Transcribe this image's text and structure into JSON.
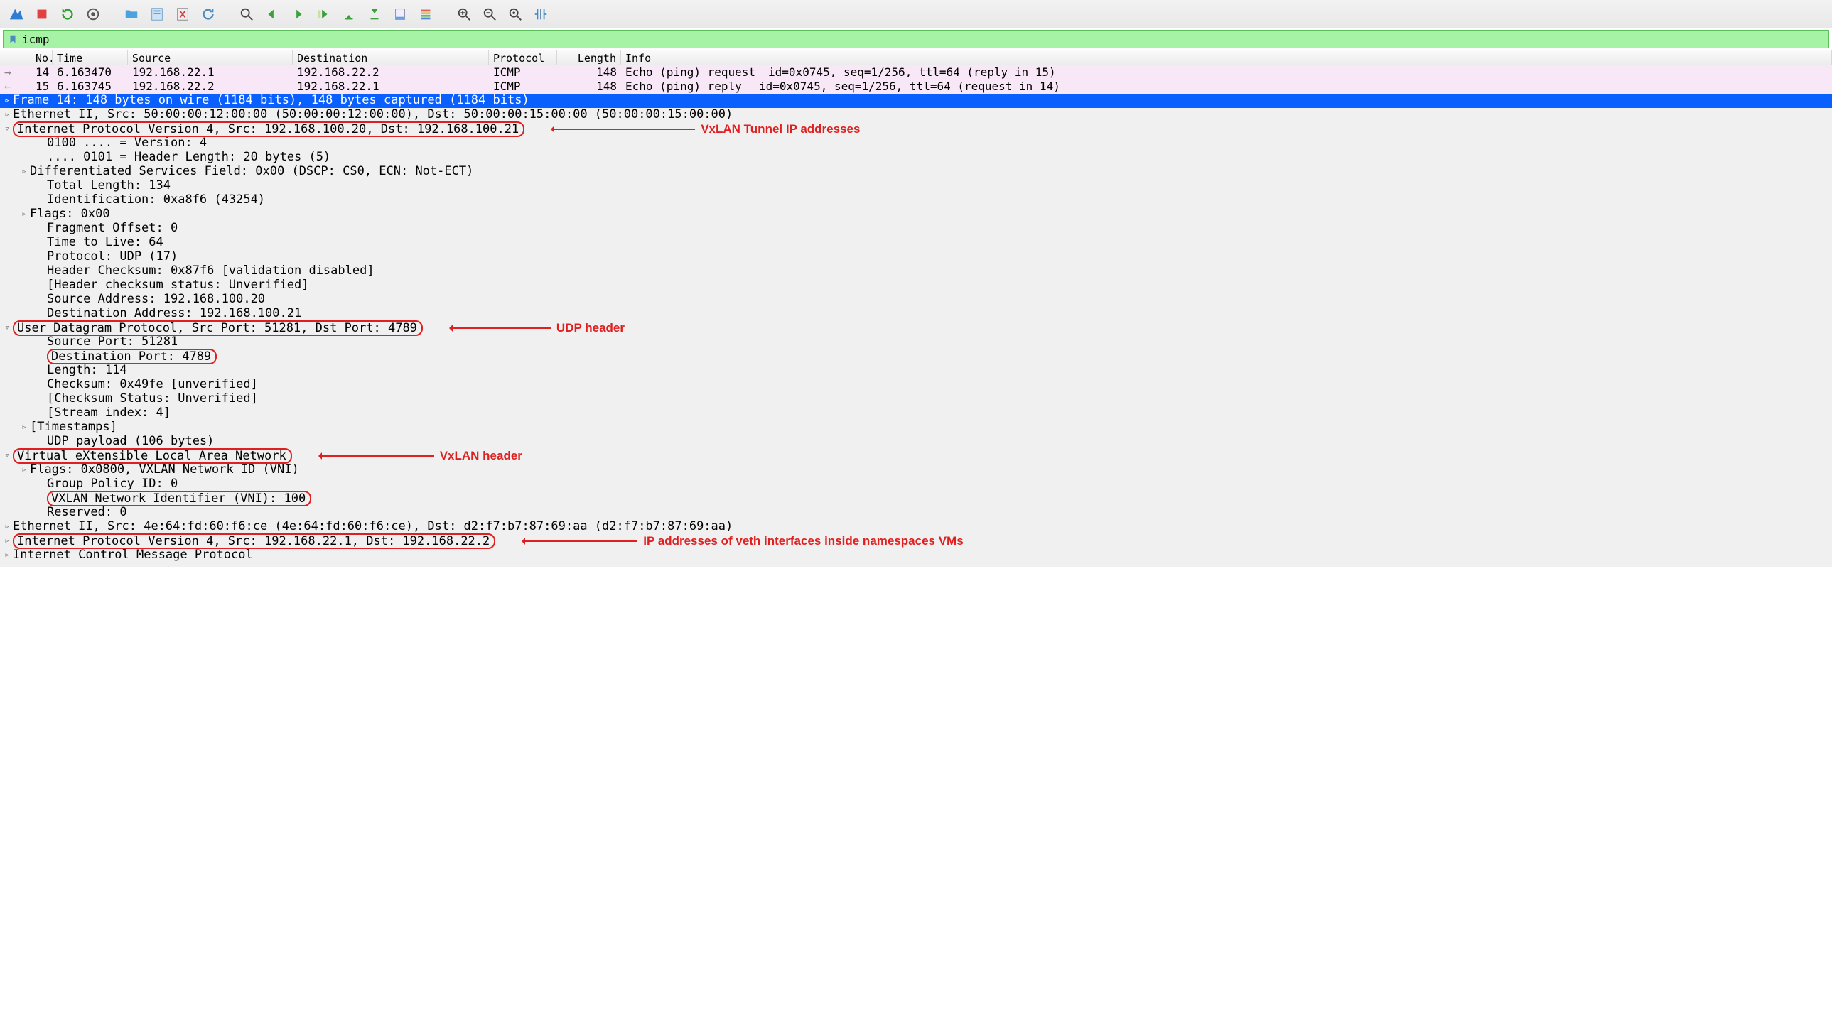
{
  "filter": {
    "value": "icmp"
  },
  "columns": {
    "no": "No.",
    "time": "Time",
    "src": "Source",
    "dst": "Destination",
    "proto": "Protocol",
    "len": "Length",
    "info": "Info"
  },
  "packets": [
    {
      "dir": "right",
      "no": "14",
      "time": "6.163470",
      "src": "192.168.22.1",
      "dst": "192.168.22.2",
      "proto": "ICMP",
      "len": "148",
      "infoDesc": "Echo (ping) request",
      "infoTail": "id=0x0745, seq=1/256, ttl=64 (reply in 15)"
    },
    {
      "dir": "left",
      "no": "15",
      "time": "6.163745",
      "src": "192.168.22.2",
      "dst": "192.168.22.1",
      "proto": "ICMP",
      "len": "148",
      "infoDesc": "Echo (ping) reply",
      "infoTail": "id=0x0745, seq=1/256, ttl=64 (request in 14)"
    }
  ],
  "tree": {
    "frame": "Frame 14: 148 bytes on wire (1184 bits), 148 bytes captured (1184 bits)",
    "eth1": "Ethernet II, Src: 50:00:00:12:00:00 (50:00:00:12:00:00), Dst: 50:00:00:15:00:00 (50:00:00:15:00:00)",
    "ip_outer": "Internet Protocol Version 4, Src: 192.168.100.20, Dst: 192.168.100.21",
    "ip_outer_fields": {
      "version": "0100 .... = Version: 4",
      "hlen": ".... 0101 = Header Length: 20 bytes (5)",
      "dsf": "Differentiated Services Field: 0x00 (DSCP: CS0, ECN: Not-ECT)",
      "tlen": "Total Length: 134",
      "ident": "Identification: 0xa8f6 (43254)",
      "flags": "Flags: 0x00",
      "foff": "Fragment Offset: 0",
      "ttl": "Time to Live: 64",
      "proto": "Protocol: UDP (17)",
      "hcksum": "Header Checksum: 0x87f6 [validation disabled]",
      "hckstat": "[Header checksum status: Unverified]",
      "saddr": "Source Address: 192.168.100.20",
      "daddr": "Destination Address: 192.168.100.21"
    },
    "udp": "User Datagram Protocol, Src Port: 51281, Dst Port: 4789",
    "udp_fields": {
      "sport": "Source Port: 51281",
      "dport": "Destination Port: 4789",
      "len": "Length: 114",
      "cksum": "Checksum: 0x49fe [unverified]",
      "ckstat": "[Checksum Status: Unverified]",
      "sidx": "[Stream index: 4]",
      "ts": "[Timestamps]",
      "payload": "UDP payload (106 bytes)"
    },
    "vxlan": "Virtual eXtensible Local Area Network",
    "vxlan_fields": {
      "flags": "Flags: 0x0800, VXLAN Network ID (VNI)",
      "gpid": "Group Policy ID: 0",
      "vni": "VXLAN Network Identifier (VNI): 100",
      "resv": "Reserved: 0"
    },
    "eth2": "Ethernet II, Src: 4e:64:fd:60:f6:ce (4e:64:fd:60:f6:ce), Dst: d2:f7:b7:87:69:aa (d2:f7:b7:87:69:aa)",
    "ip_inner": "Internet Protocol Version 4, Src: 192.168.22.1, Dst: 192.168.22.2",
    "icmp": "Internet Control Message Protocol"
  },
  "annotations": {
    "tunnel": "VxLAN Tunnel IP addresses",
    "udp": "UDP header",
    "vxlan": "VxLAN header",
    "inner": "IP addresses of veth interfaces inside namespaces VMs"
  }
}
